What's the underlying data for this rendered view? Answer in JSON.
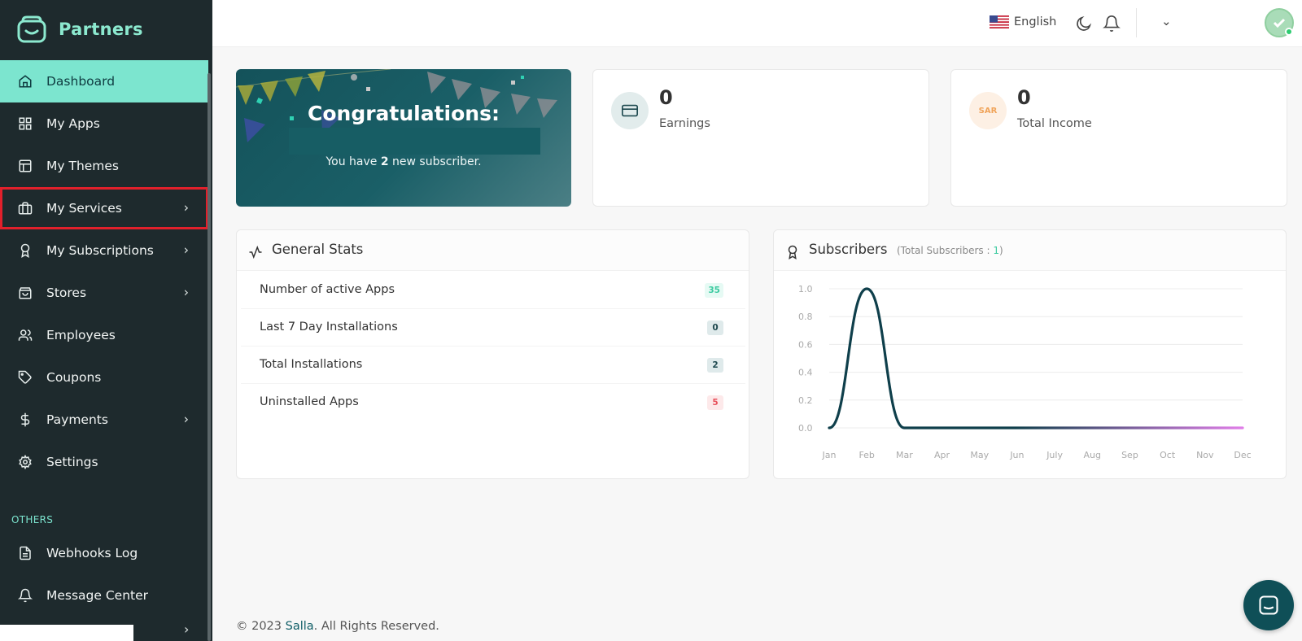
{
  "brand": {
    "name": "Partners"
  },
  "sidebar": {
    "items": [
      {
        "label": "Dashboard",
        "icon": "home-icon",
        "active": true
      },
      {
        "label": "My Apps",
        "icon": "grid-icon"
      },
      {
        "label": "My Themes",
        "icon": "layout-icon"
      },
      {
        "label": "My Services",
        "icon": "briefcase-icon",
        "chevron": true,
        "highlighted": true
      },
      {
        "label": "My Subscriptions",
        "icon": "award-icon",
        "chevron": true
      },
      {
        "label": "Stores",
        "icon": "shopping-bag-icon",
        "chevron": true
      },
      {
        "label": "Employees",
        "icon": "users-icon"
      },
      {
        "label": "Coupons",
        "icon": "tag-icon"
      },
      {
        "label": "Payments",
        "icon": "dollar-icon",
        "chevron": true
      },
      {
        "label": "Settings",
        "icon": "gear-icon"
      }
    ],
    "others_label": "OTHERS",
    "others": [
      {
        "label": "Webhooks Log",
        "icon": "file-text-icon"
      },
      {
        "label": "Message Center",
        "icon": "bell-icon"
      }
    ]
  },
  "header": {
    "language": "English",
    "icons": [
      "us-flag-icon",
      "moon-icon",
      "bell-icon",
      "chevron-down-icon",
      "avatar"
    ]
  },
  "congrats": {
    "title": "Congratulations:",
    "sub_before": "You have ",
    "sub_count": "2",
    "sub_after": " new subscriber."
  },
  "earnings": {
    "value": "0",
    "label": "Earnings"
  },
  "income": {
    "value": "0",
    "label": "Total Income",
    "currency": "SAR"
  },
  "general_stats": {
    "title": "General Stats",
    "rows": [
      {
        "label": "Number of active Apps",
        "value": "35",
        "color": "#3ccaa0",
        "bg": "#e6faf4"
      },
      {
        "label": "Last 7 Day Installations",
        "value": "0",
        "color": "#1f4a50",
        "bg": "#dfeaeb"
      },
      {
        "label": "Total Installations",
        "value": "2",
        "color": "#1f4a50",
        "bg": "#dfeaeb"
      },
      {
        "label": "Uninstalled Apps",
        "value": "5",
        "color": "#e8505b",
        "bg": "#fde9ea"
      }
    ]
  },
  "subscribers": {
    "title": "Subscribers",
    "total_label": "(Total Subscribers : ",
    "total_value": "1",
    "total_close": ")"
  },
  "chart_data": {
    "type": "line",
    "categories": [
      "Jan",
      "Feb",
      "Mar",
      "Apr",
      "May",
      "Jun",
      "July",
      "Aug",
      "Sep",
      "Oct",
      "Nov",
      "Dec"
    ],
    "series": [
      {
        "values": [
          0,
          1,
          0,
          0,
          0,
          0,
          0,
          0,
          0,
          0,
          0,
          0
        ]
      }
    ],
    "yticks": [
      "0.0",
      "0.2",
      "0.4",
      "0.6",
      "0.8",
      "1.0"
    ],
    "ylim": [
      0,
      1
    ],
    "grid": true,
    "colors": {
      "start": "#0f3f4b",
      "end": "#e07ee8"
    }
  },
  "footer": {
    "prefix": "© 2023 ",
    "brand": "Salla",
    "suffix": ". All Rights Reserved."
  }
}
